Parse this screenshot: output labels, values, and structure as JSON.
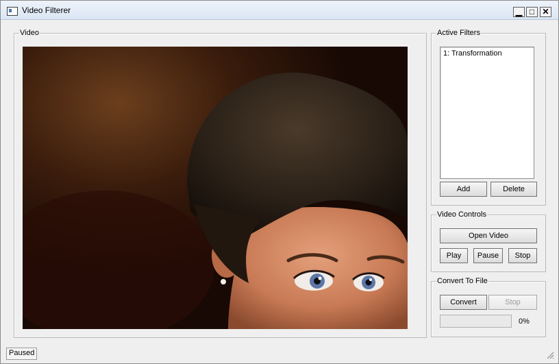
{
  "window": {
    "title": "Video Filterer",
    "minimize_glyph": "▁",
    "maximize_glyph": "□",
    "close_glyph": "✕"
  },
  "video": {
    "group_label": "Video"
  },
  "filters": {
    "group_label": "Active Filters",
    "items": [
      "1: Transformation"
    ],
    "add_label": "Add",
    "delete_label": "Delete"
  },
  "controls": {
    "group_label": "Video Controls",
    "open_label": "Open Video",
    "play_label": "Play",
    "pause_label": "Pause",
    "stop_label": "Stop"
  },
  "convert": {
    "group_label": "Convert To File",
    "convert_label": "Convert",
    "stop_label": "Stop",
    "progress": 0,
    "progress_text": "0%"
  },
  "status": {
    "text": "Paused"
  },
  "colors": {
    "titlebar": "#dbe6f4",
    "window_bg": "#efefef",
    "progress_fill": "#7db8e6"
  }
}
